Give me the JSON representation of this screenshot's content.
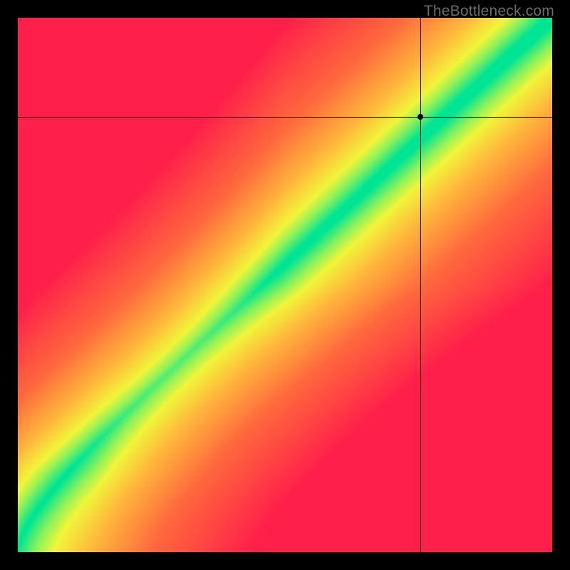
{
  "watermark": "TheBottleneck.com",
  "chart_data": {
    "type": "heatmap",
    "title": "",
    "xlabel": "",
    "ylabel": "",
    "xlim": [
      0,
      1
    ],
    "ylim": [
      0,
      1
    ],
    "grid": false,
    "crosshair": {
      "x": 0.755,
      "y": 0.815
    },
    "marker": {
      "x": 0.755,
      "y": 0.815
    },
    "optimal_curve": {
      "description": "Green ridge where subscore is 1.0; points are (x, f(x)) with x on horizontal axis and f(x) on vertical axis (both normalized 0–1). Curve starts at origin with slope ~1 then bends upward to slope ~2 in the upper half.",
      "x": [
        0,
        0.1,
        0.2,
        0.3,
        0.4,
        0.5,
        0.6,
        0.7,
        0.8,
        0.9,
        1.0
      ],
      "y": [
        0,
        0.11,
        0.23,
        0.355,
        0.485,
        0.62,
        0.73,
        0.82,
        0.89,
        0.945,
        1.0
      ]
    },
    "color_stops": {
      "description": "Score→color mapping for the heatmap; score 0 at ridge, grows with distance from ridge.",
      "stops": [
        {
          "score": 0.0,
          "color": "#00e594"
        },
        {
          "score": 0.08,
          "color": "#8ef25a"
        },
        {
          "score": 0.15,
          "color": "#f1f53a"
        },
        {
          "score": 0.3,
          "color": "#ffb63c"
        },
        {
          "score": 0.55,
          "color": "#ff6a3d"
        },
        {
          "score": 1.0,
          "color": "#ff1f4a"
        }
      ]
    },
    "legend": null
  }
}
